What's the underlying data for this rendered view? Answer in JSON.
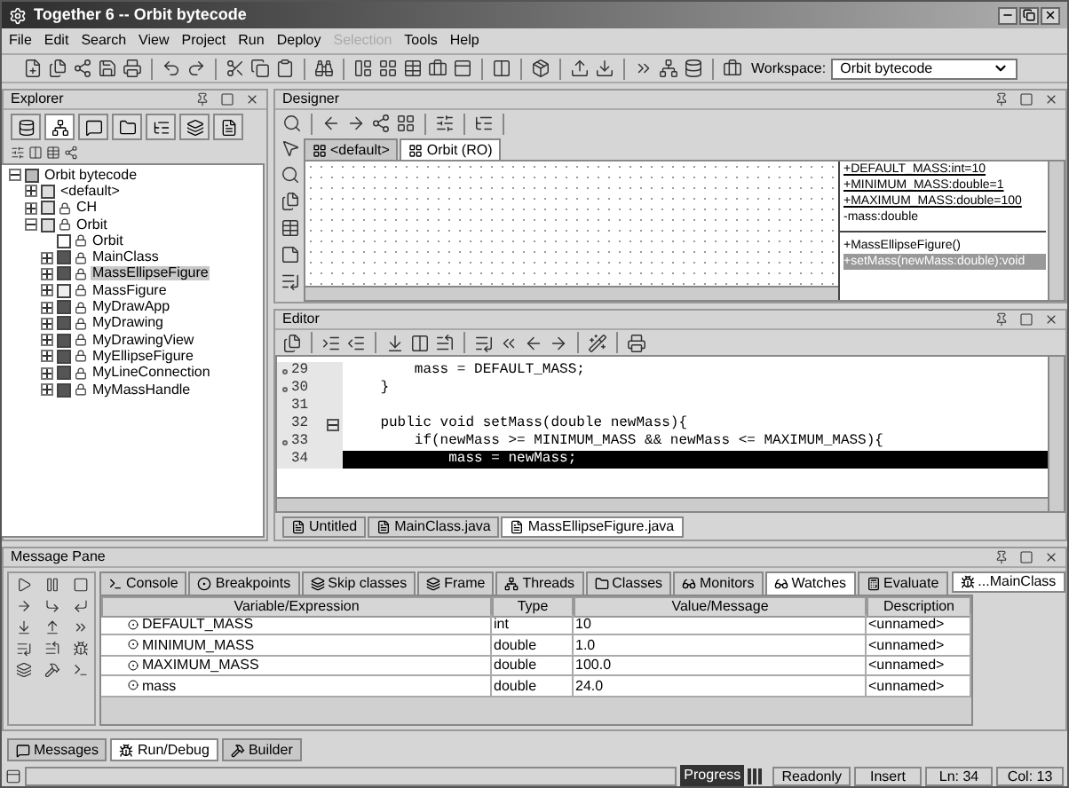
{
  "window": {
    "title": "Together 6 -- Orbit bytecode"
  },
  "menu": [
    {
      "label": "File",
      "disabled": false
    },
    {
      "label": "Edit",
      "disabled": false
    },
    {
      "label": "Search",
      "disabled": false
    },
    {
      "label": "View",
      "disabled": false
    },
    {
      "label": "Project",
      "disabled": false
    },
    {
      "label": "Run",
      "disabled": false
    },
    {
      "label": "Deploy",
      "disabled": false
    },
    {
      "label": "Selection",
      "disabled": true
    },
    {
      "label": "Tools",
      "disabled": false
    },
    {
      "label": "Help",
      "disabled": false
    }
  ],
  "toolbar": {
    "workspace_label": "Workspace:",
    "workspace_value": "Orbit bytecode"
  },
  "explorer": {
    "title": "Explorer",
    "tree": [
      {
        "label": "Orbit bytecode",
        "kind": "project",
        "locked": false,
        "selected": false,
        "expanded": true,
        "children": [
          {
            "label": "<default>",
            "kind": "package",
            "locked": false,
            "selected": false,
            "expanded": false
          },
          {
            "label": "CH",
            "kind": "package",
            "locked": true,
            "selected": false,
            "expanded": false
          },
          {
            "label": "Orbit",
            "kind": "package",
            "locked": true,
            "selected": false,
            "expanded": true,
            "children": [
              {
                "label": "Orbit",
                "kind": "diagram",
                "locked": true,
                "selected": false
              },
              {
                "label": "MainClass",
                "kind": "class",
                "locked": true,
                "selected": false,
                "expanded": false
              },
              {
                "label": "MassEllipseFigure",
                "kind": "class",
                "locked": true,
                "selected": true,
                "expanded": false
              },
              {
                "label": "MassFigure",
                "kind": "interface",
                "locked": true,
                "selected": false,
                "expanded": false
              },
              {
                "label": "MyDrawApp",
                "kind": "class",
                "locked": true,
                "selected": false,
                "expanded": false
              },
              {
                "label": "MyDrawing",
                "kind": "class",
                "locked": true,
                "selected": false,
                "expanded": false
              },
              {
                "label": "MyDrawingView",
                "kind": "class",
                "locked": true,
                "selected": false,
                "expanded": false
              },
              {
                "label": "MyEllipseFigure",
                "kind": "class",
                "locked": true,
                "selected": false,
                "expanded": false
              },
              {
                "label": "MyLineConnection",
                "kind": "class",
                "locked": true,
                "selected": false,
                "expanded": false
              },
              {
                "label": "MyMassHandle",
                "kind": "class",
                "locked": true,
                "selected": false,
                "expanded": false
              }
            ]
          }
        ]
      }
    ]
  },
  "designer": {
    "title": "Designer",
    "tabs": [
      {
        "label": "<default>",
        "selected": false
      },
      {
        "label": "Orbit (RO)",
        "selected": true
      }
    ],
    "class_box": {
      "attributes": [
        {
          "text": "+DEFAULT_MASS:int=10",
          "static": true
        },
        {
          "text": "+MINIMUM_MASS:double=1",
          "static": true
        },
        {
          "text": "+MAXIMUM_MASS:double=100",
          "static": true
        },
        {
          "text": "-mass:double",
          "static": false
        }
      ],
      "operations": [
        {
          "text": "+MassEllipseFigure()",
          "selected": false
        },
        {
          "text": "+setMass(newMass:double):void",
          "selected": true
        }
      ]
    }
  },
  "editor": {
    "title": "Editor",
    "lines": [
      {
        "number": "29",
        "code": "        mass = DEFAULT_MASS;",
        "marker": true,
        "fold": false,
        "current": false
      },
      {
        "number": "30",
        "code": "    }",
        "marker": true,
        "fold": false,
        "current": false
      },
      {
        "number": "31",
        "marker": false,
        "fold": false,
        "current": false
      },
      {
        "number": "32",
        "code": "    public void setMass(double newMass){",
        "marker": false,
        "fold": true,
        "current": false
      },
      {
        "number": "33",
        "code": "        if(newMass >= MINIMUM_MASS && newMass <= MAXIMUM_MASS){",
        "marker": true,
        "fold": false,
        "current": false
      },
      {
        "number": "34",
        "code": "            mass = newMass;",
        "marker": false,
        "fold": false,
        "current": true
      }
    ],
    "tabs": [
      {
        "label": "Untitled",
        "selected": false
      },
      {
        "label": "MainClass.java",
        "selected": false
      },
      {
        "label": "MassEllipseFigure.java",
        "selected": true
      }
    ]
  },
  "message_pane": {
    "title": "Message Pane",
    "tabs": [
      {
        "label": "Console",
        "selected": false
      },
      {
        "label": "Breakpoints",
        "selected": false
      },
      {
        "label": "Skip classes",
        "selected": false
      },
      {
        "label": "Frame",
        "selected": false
      },
      {
        "label": "Threads",
        "selected": false
      },
      {
        "label": "Classes",
        "selected": false
      },
      {
        "label": "Monitors",
        "selected": false
      },
      {
        "label": "Watches",
        "selected": true
      },
      {
        "label": "Evaluate",
        "selected": false
      }
    ],
    "columns": [
      "Variable/Expression",
      "Type",
      "Value/Message",
      "Description"
    ],
    "rows": [
      [
        "DEFAULT_MASS",
        "int",
        "10",
        "<unnamed>"
      ],
      [
        "MINIMUM_MASS",
        "double",
        "1.0",
        "<unnamed>"
      ],
      [
        "MAXIMUM_MASS",
        "double",
        "100.0",
        "<unnamed>"
      ],
      [
        "mass",
        "double",
        "24.0",
        "<unnamed>"
      ]
    ],
    "side_tab": "...MainClass"
  },
  "bottom_tabs": [
    {
      "label": "Messages",
      "selected": false
    },
    {
      "label": "Run/Debug",
      "selected": true
    },
    {
      "label": "Builder",
      "selected": false
    }
  ],
  "status_bar": {
    "progress": "Progress",
    "mode": "Readonly",
    "insert": "Insert",
    "line": "Ln: 34",
    "column": "Col: 13"
  }
}
